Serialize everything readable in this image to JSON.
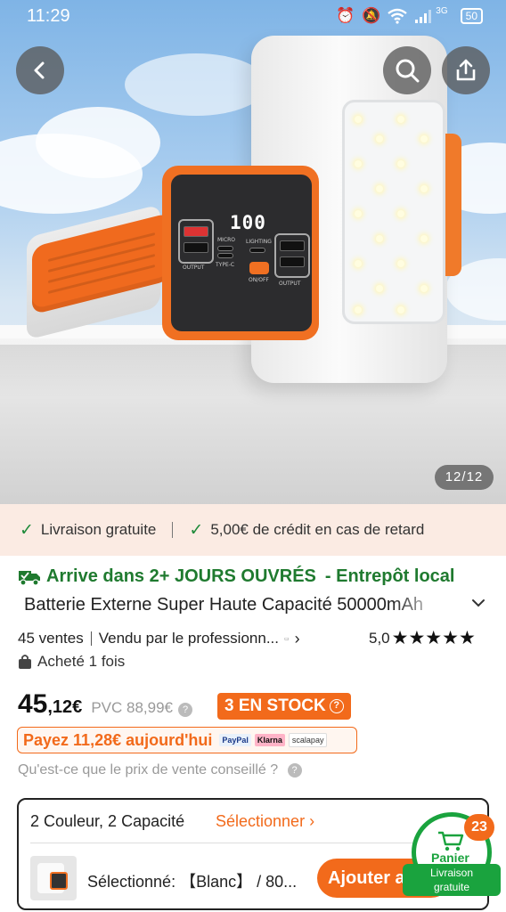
{
  "status_bar": {
    "time": "11:29",
    "network": "3G",
    "battery": "50",
    "icons": [
      "alarm-icon",
      "mute-icon",
      "wifi-icon",
      "signal-icon",
      "battery-icon"
    ]
  },
  "nav": {
    "back_icon": "chevron-left-icon",
    "search_icon": "search-icon",
    "share_icon": "share-icon"
  },
  "gallery": {
    "counter": "12/12",
    "product_display": "100",
    "port_labels": [
      "OUTPUT",
      "MICRO",
      "TYPE-C",
      "LIGHTING",
      "ON/OFF",
      "OUTPUT"
    ]
  },
  "delivery_strip": {
    "item1": "Livraison gratuite",
    "item2": "5,00€ de crédit en cas de retard"
  },
  "product": {
    "arrive": "Arrive dans 2+ JOURS OUVRÉS",
    "warehouse": "- Entrepôt local",
    "title": "Batterie Externe Super Haute Capacité 50000mAh",
    "sales": "45 ventes",
    "seller": "Vendu par le professionn...",
    "rating": "5,0",
    "stars": "★★★★★",
    "bought": "Acheté 1 fois"
  },
  "price": {
    "integer": "45",
    "decimal": ",12€",
    "pvc": "PVC 88,99€",
    "stock": "3 EN STOCK",
    "pay_today": "Payez 11,28€ aujourd'hui",
    "pay_methods": [
      "PayPal",
      "Klarna",
      "scalapay"
    ],
    "conseil": "Qu'est-ce que le prix de vente conseillé ?"
  },
  "selection": {
    "title": "2 Couleur, 2 Capacité",
    "link": "Sélectionner",
    "selected": "Sélectionné:  【Blanc】 / 80...",
    "add_button": "Ajouter au panier"
  },
  "cart": {
    "badge": "23",
    "label": "Panier",
    "shipping_line1": "Livraison",
    "shipping_line2": "gratuite"
  },
  "colors": {
    "accent": "#f26a1b",
    "green": "#1aa33e",
    "delivery_green": "#1f7a2f",
    "strip_bg": "#fbebe3"
  }
}
